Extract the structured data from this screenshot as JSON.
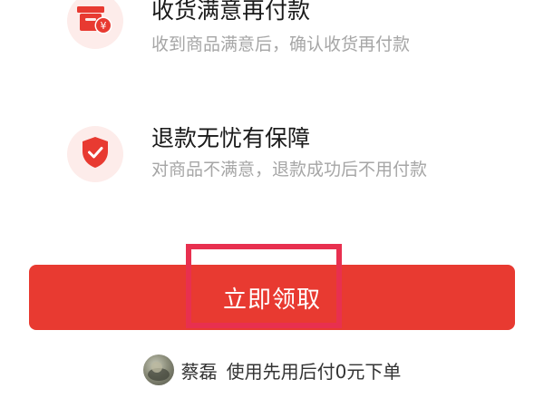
{
  "features": [
    {
      "title": "收货满意再付款",
      "description": "收到商品满意后，确认收货再付款",
      "icon": "box-yen-icon"
    },
    {
      "title": "退款无忧有保障",
      "description": "对商品不满意，退款成功后不用付款",
      "icon": "shield-check-icon"
    }
  ],
  "action": {
    "claim_label": "立即领取"
  },
  "footer": {
    "user_name": "蔡磊",
    "message": "使用先用后付0元下单"
  },
  "colors": {
    "primary_red": "#e83a31",
    "icon_bg": "#fdecea",
    "highlight": "#e8304f",
    "muted_text": "#a6a6a6"
  }
}
